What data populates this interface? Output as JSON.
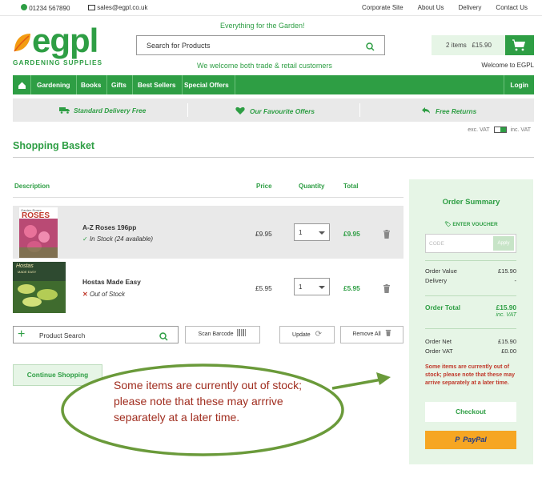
{
  "topbar": {
    "phone": "01234 567890",
    "email": "sales@egpl.co.uk",
    "links": [
      "Corporate Site",
      "About Us",
      "Delivery",
      "Contact Us"
    ]
  },
  "header": {
    "logo_text": "egpl",
    "logo_sub": "GARDENING SUPPLIES",
    "tagline": "Everything for the Garden!",
    "trade": "We welcome both trade & retail customers",
    "search_placeholder": "Search for Products",
    "basket_items": "2 items",
    "basket_total": "£15.90",
    "welcome": "Welcome to EGPL"
  },
  "nav": {
    "items": [
      "Gardening",
      "Books",
      "Gifts",
      "Best Sellers",
      "Special Offers"
    ],
    "login": "Login"
  },
  "strip": {
    "delivery": "Standard Delivery Free",
    "offers": "Our Favourite Offers",
    "returns": "Free Returns"
  },
  "vat": {
    "ex": "exc. VAT",
    "inc": "inc. VAT"
  },
  "page_title": "Shopping Basket",
  "table": {
    "headers": {
      "description": "Description",
      "price": "Price",
      "quantity": "Quantity",
      "total": "Total"
    },
    "rows": [
      {
        "name": "A-Z Roses 196pp",
        "stock": "In Stock (24 available)",
        "price": "£9.95",
        "qty": "1",
        "total": "£9.95",
        "cover_title": "ROSES",
        "cover_top": "Garden Roses"
      },
      {
        "name": "Hostas Made Easy",
        "stock": "Out of Stock",
        "price": "£5.95",
        "qty": "1",
        "total": "£5.95",
        "cover_title": "Hostas",
        "cover_top": "MADE EASY"
      }
    ]
  },
  "tools": {
    "product_search": "Product Search",
    "scan": "Scan Barcode",
    "update": "Update",
    "remove": "Remove All"
  },
  "continue": "Continue Shopping",
  "summary": {
    "title": "Order Summary",
    "voucher": "ENTER VOUCHER",
    "code_placeholder": "CODE",
    "apply": "Apply",
    "order_value_label": "Order Value",
    "order_value": "£15.90",
    "delivery_label": "Delivery",
    "delivery": "-",
    "order_total_label": "Order Total",
    "order_total": "£15.90",
    "inc_vat": "inc. VAT",
    "order_net_label": "Order Net",
    "order_net": "£15.90",
    "order_vat_label": "Order VAT",
    "order_vat": "£0.00",
    "warning": "Some items are currently out of stock; please note that these may arrive separately at a later time.",
    "checkout": "Checkout",
    "paypal": "PayPal"
  },
  "callout": "Some items are currently out of stock; please note that these may arrrive separately at a later time.",
  "colors": {
    "brand_green": "#2e9e44",
    "warning_red": "#c0392b",
    "paypal_orange": "#f6a623"
  }
}
